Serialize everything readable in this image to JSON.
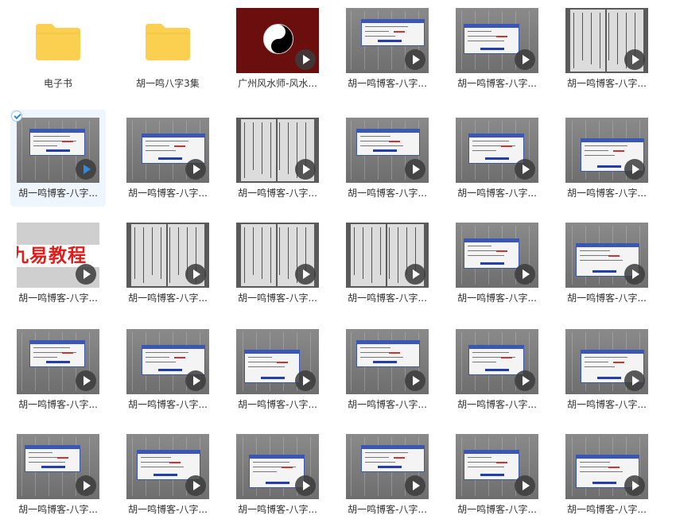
{
  "colors": {
    "folder": "#fbd051",
    "selected_bg": "#eef5fd",
    "play_selected": "#2f8be6",
    "banner_red": "#e21b1b"
  },
  "items": [
    {
      "label": "电子书",
      "kind": "folder",
      "icon": "folder-icon"
    },
    {
      "label": "胡一鸣八字3集",
      "kind": "folder",
      "icon": "folder-icon"
    },
    {
      "label": "广州风水师-风水...",
      "kind": "video",
      "art": "taiji"
    },
    {
      "label": "胡一鸣博客-八字...",
      "kind": "video",
      "art": "dialog"
    },
    {
      "label": "胡一鸣博客-八字...",
      "kind": "video",
      "art": "dialog"
    },
    {
      "label": "胡一鸣博客-八字...",
      "kind": "video",
      "art": "book"
    },
    {
      "label": "胡一鸣博客-八字...",
      "kind": "video",
      "art": "dialog",
      "selected": true
    },
    {
      "label": "胡一鸣博客-八字...",
      "kind": "video",
      "art": "dialog"
    },
    {
      "label": "胡一鸣博客-八字...",
      "kind": "video",
      "art": "book"
    },
    {
      "label": "胡一鸣博客-八字...",
      "kind": "video",
      "art": "dialog"
    },
    {
      "label": "胡一鸣博客-八字...",
      "kind": "video",
      "art": "dialog"
    },
    {
      "label": "胡一鸣博客-八字...",
      "kind": "video",
      "art": "dialog"
    },
    {
      "label": "胡一鸣博客-八字...",
      "kind": "video",
      "art": "banner",
      "banner": "九易教程"
    },
    {
      "label": "胡一鸣博客-八字...",
      "kind": "video",
      "art": "book"
    },
    {
      "label": "胡一鸣博客-八字...",
      "kind": "video",
      "art": "book"
    },
    {
      "label": "胡一鸣博客-八字...",
      "kind": "video",
      "art": "book"
    },
    {
      "label": "胡一鸣博客-八字...",
      "kind": "video",
      "art": "dialog"
    },
    {
      "label": "胡一鸣博客-八字...",
      "kind": "video",
      "art": "dialog"
    },
    {
      "label": "胡一鸣博客-八字...",
      "kind": "video",
      "art": "dialog"
    },
    {
      "label": "胡一鸣博客-八字...",
      "kind": "video",
      "art": "dialog"
    },
    {
      "label": "胡一鸣博客-八字...",
      "kind": "video",
      "art": "dialog"
    },
    {
      "label": "胡一鸣博客-八字...",
      "kind": "video",
      "art": "dialog"
    },
    {
      "label": "胡一鸣博客-八字...",
      "kind": "video",
      "art": "dialog"
    },
    {
      "label": "胡一鸣博客-八字...",
      "kind": "video",
      "art": "dialog"
    },
    {
      "label": "胡一鸣博客-八字...",
      "kind": "video",
      "art": "dialog"
    },
    {
      "label": "胡一鸣博客-八字...",
      "kind": "video",
      "art": "dialog"
    },
    {
      "label": "胡一鸣博客-八字...",
      "kind": "video",
      "art": "dialog"
    },
    {
      "label": "胡一鸣博客-八字...",
      "kind": "video",
      "art": "dialog"
    },
    {
      "label": "胡一鸣博客-八字...",
      "kind": "video",
      "art": "dialog"
    },
    {
      "label": "胡一鸣博客-八字...",
      "kind": "video",
      "art": "dialog"
    }
  ]
}
